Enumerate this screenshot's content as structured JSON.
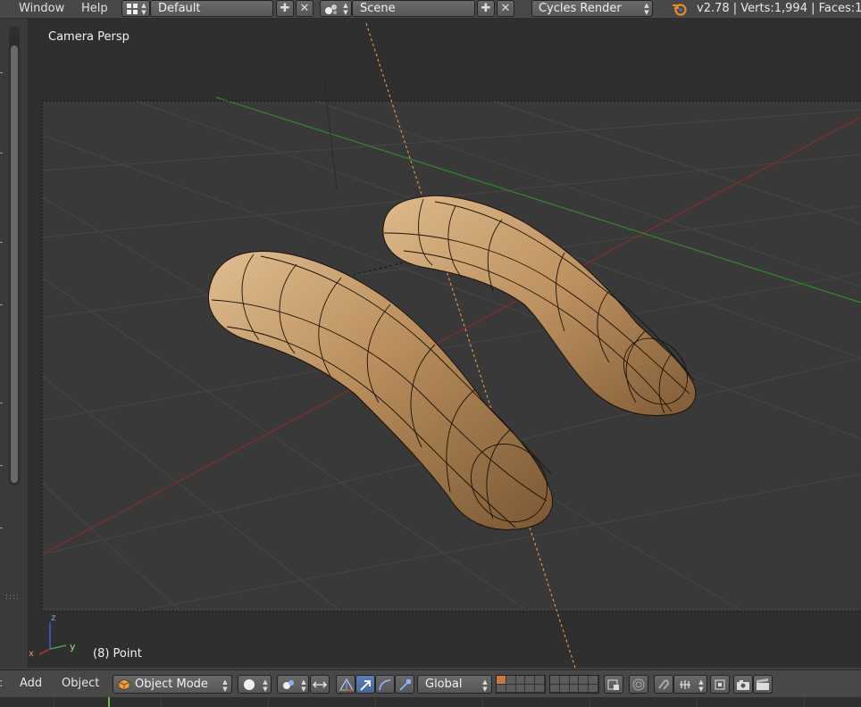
{
  "topbar": {
    "menus": [
      "Window",
      "Help"
    ],
    "screen_layout": "Default",
    "scene": "Scene",
    "render_engine": "Cycles Render",
    "stats": "v2.78 | Verts:1,994 | Faces:1,9"
  },
  "viewport": {
    "view_name": "Camera Persp",
    "object_info": "(8) Point",
    "axis_labels": {
      "x": "x",
      "y": "y",
      "z": "z"
    }
  },
  "bottombar": {
    "menus": [
      "Add",
      "Object"
    ],
    "mode": "Object Mode",
    "transform_orientation": "Global"
  },
  "icons": {
    "layout": "screen-layout-icon",
    "scene": "scene-icon",
    "blender": "blender-logo-icon",
    "mode": "object-mode-cube-icon"
  },
  "colors": {
    "grid_bg": "#393939",
    "x_axis": "#b03030",
    "y_axis": "#3a9a30",
    "mesh": "#c59a68",
    "lamp_line": "#e8a040",
    "active_blue": "#5a7fb5"
  }
}
